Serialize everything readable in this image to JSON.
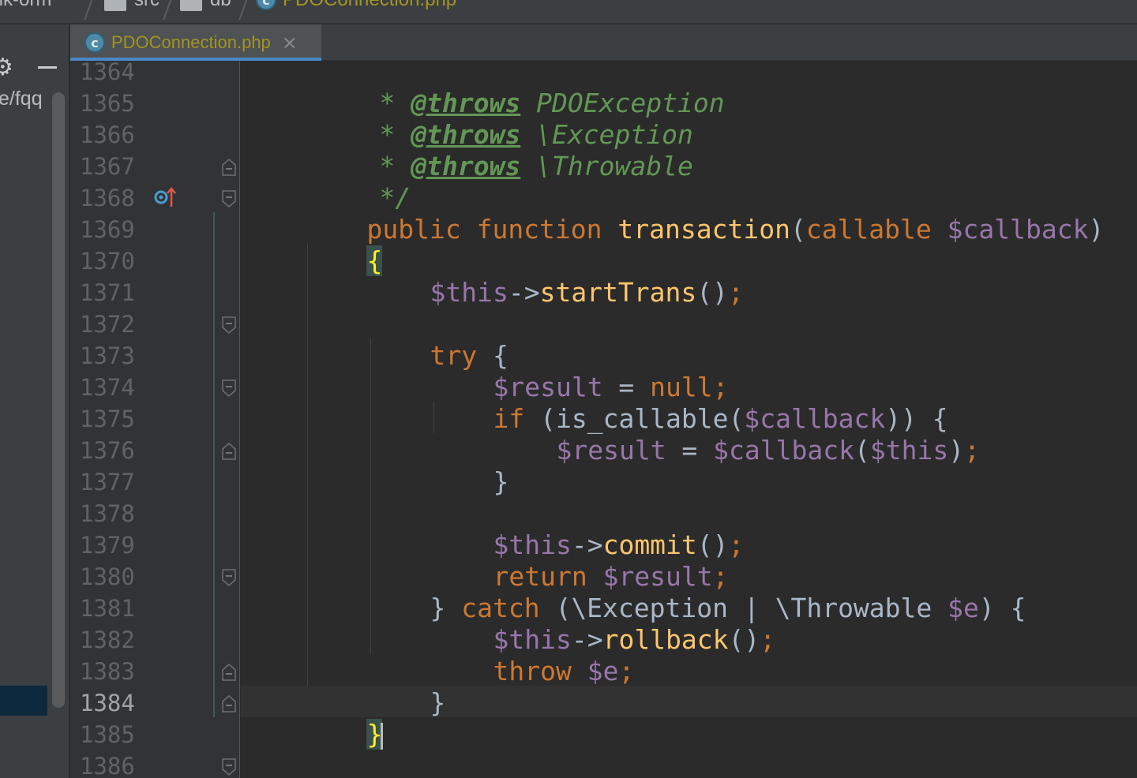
{
  "breadcrumb": {
    "items": [
      {
        "label": "link-orm",
        "type": "project"
      },
      {
        "label": "src",
        "type": "folder"
      },
      {
        "label": "db",
        "type": "folder"
      },
      {
        "label": "PDOConnection.php",
        "type": "file"
      }
    ]
  },
  "project_panel": {
    "visible_path_text": "e/fqq",
    "gear_icon": "gear-icon",
    "minimize_icon": "minimize-icon"
  },
  "tabs": [
    {
      "label": "PDOConnection.php",
      "active": true,
      "icon": "php-class-icon",
      "close_glyph": "×"
    }
  ],
  "editor": {
    "current_line": "1384",
    "gutter_lines": [
      "1364",
      "1365",
      "1366",
      "1367",
      "1368",
      "1369",
      "1370",
      "1371",
      "1372",
      "1373",
      "1374",
      "1375",
      "1376",
      "1377",
      "1378",
      "1379",
      "1380",
      "1381",
      "1382",
      "1383",
      "1384",
      "1385",
      "1386"
    ],
    "code": {
      "l1364": {
        "star": "* ",
        "tag": "@throws",
        "rest": " PDOException"
      },
      "l1365": {
        "star": "* ",
        "tag": "@throws",
        "rest": " \\Exception"
      },
      "l1366": {
        "star": "* ",
        "tag": "@throws",
        "rest": " \\Throwable"
      },
      "l1367": {
        "text": "*/"
      },
      "l1368": {
        "kw1": "public",
        "kw2": "function",
        "name": "transaction",
        "open": "(",
        "kw3": "callable",
        "var": "$callback",
        "close": ")"
      },
      "l1369": {
        "brace": "{"
      },
      "l1370": {
        "var": "$this",
        "arrow": "->",
        "fn": "startTrans",
        "paren": "()",
        "semi": ";"
      },
      "l1372": {
        "kw": "try",
        "rest": " {"
      },
      "l1373": {
        "var": "$result",
        "op": " = ",
        "kw": "null",
        "semi": ";"
      },
      "l1374": {
        "kw": "if",
        "pre": " (is_callable(",
        "var": "$callback",
        "post": ")) {"
      },
      "l1375": {
        "var1": "$result",
        "op": " = ",
        "var2": "$callback",
        "open": "(",
        "var3": "$this",
        "close": ")",
        "semi": ";"
      },
      "l1376": {
        "text": "}"
      },
      "l1378": {
        "var": "$this",
        "arrow": "->",
        "fn": "commit",
        "paren": "()",
        "semi": ";"
      },
      "l1379": {
        "kw": "return",
        "var": " $result",
        "semi": ";"
      },
      "l1380": {
        "close": "} ",
        "kw": "catch",
        "pre": " (\\Exception | \\Throwable ",
        "var": "$e",
        "post": ") {"
      },
      "l1381": {
        "var": "$this",
        "arrow": "->",
        "fn": "rollback",
        "paren": "()",
        "semi": ";"
      },
      "l1382": {
        "kw": "throw",
        "var": " $e",
        "semi": ";"
      },
      "l1383": {
        "text": "}"
      },
      "l1384": {
        "brace": "}"
      },
      "l1386": {
        "text": "/**"
      }
    }
  },
  "colors": {
    "background": "#2b2b2b",
    "gutter": "#313335",
    "keyword": "#cc7832",
    "function": "#ffc66d",
    "variable": "#9876aa",
    "doc_comment": "#629755",
    "plain": "#a9b7c6",
    "tab_file": "#a39424",
    "tab_underline": "#4a88c7"
  }
}
